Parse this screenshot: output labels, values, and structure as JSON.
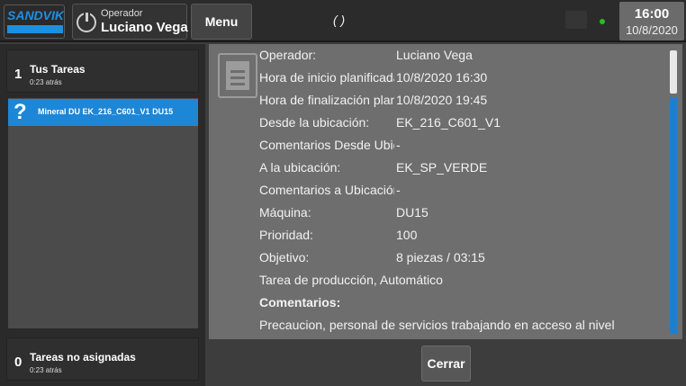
{
  "header": {
    "logo_text": "SANDVIK",
    "operator_label": "Operador",
    "operator_name": "Luciano Vega",
    "menu_label": "Menu",
    "status_text": "( )",
    "time": "16:00",
    "date": "10/8/2020",
    "status_dot_color": "#25c025"
  },
  "left_panel": {
    "my_tasks": {
      "count": "1",
      "title": "Tus Tareas",
      "subtitle": "0:23 atrás"
    },
    "task_items": [
      {
        "icon": "question-icon",
        "label": "Mineral DU  EK_216_C601_V1  DU15"
      }
    ],
    "unassigned": {
      "count": "0",
      "title": "Tareas no asignadas",
      "subtitle": "0:23 atrás"
    }
  },
  "details": {
    "rows": [
      {
        "label": "Operador:",
        "value": "Luciano Vega"
      },
      {
        "label": "Hora de inicio planificada:",
        "value": "10/8/2020 16:30"
      },
      {
        "label": "Hora de finalización planificada:",
        "value": "10/8/2020 19:45"
      },
      {
        "label": "Desde la ubicación:",
        "value": "EK_216_C601_V1"
      },
      {
        "label": "Comentarios Desde Ubicación:",
        "value": "-"
      },
      {
        "label": "A la ubicación:",
        "value": "EK_SP_VERDE"
      },
      {
        "label": "Comentarios a Ubicación:",
        "value": "-"
      },
      {
        "label": "Máquina:",
        "value": "DU15"
      },
      {
        "label": "Prioridad:",
        "value": "100"
      },
      {
        "label": "Objetivo:",
        "value": "8 piezas / 03:15"
      }
    ],
    "task_type": "Tarea de producción, Automático",
    "comments_heading": "Comentarios:",
    "comments_text": "Precaucion, personal de servicios trabajando en acceso al nivel"
  },
  "footer": {
    "close_label": "Cerrar"
  },
  "colors": {
    "accent": "#1e86d6",
    "panel": "#6e6e6e",
    "background": "#3d3d3d"
  }
}
